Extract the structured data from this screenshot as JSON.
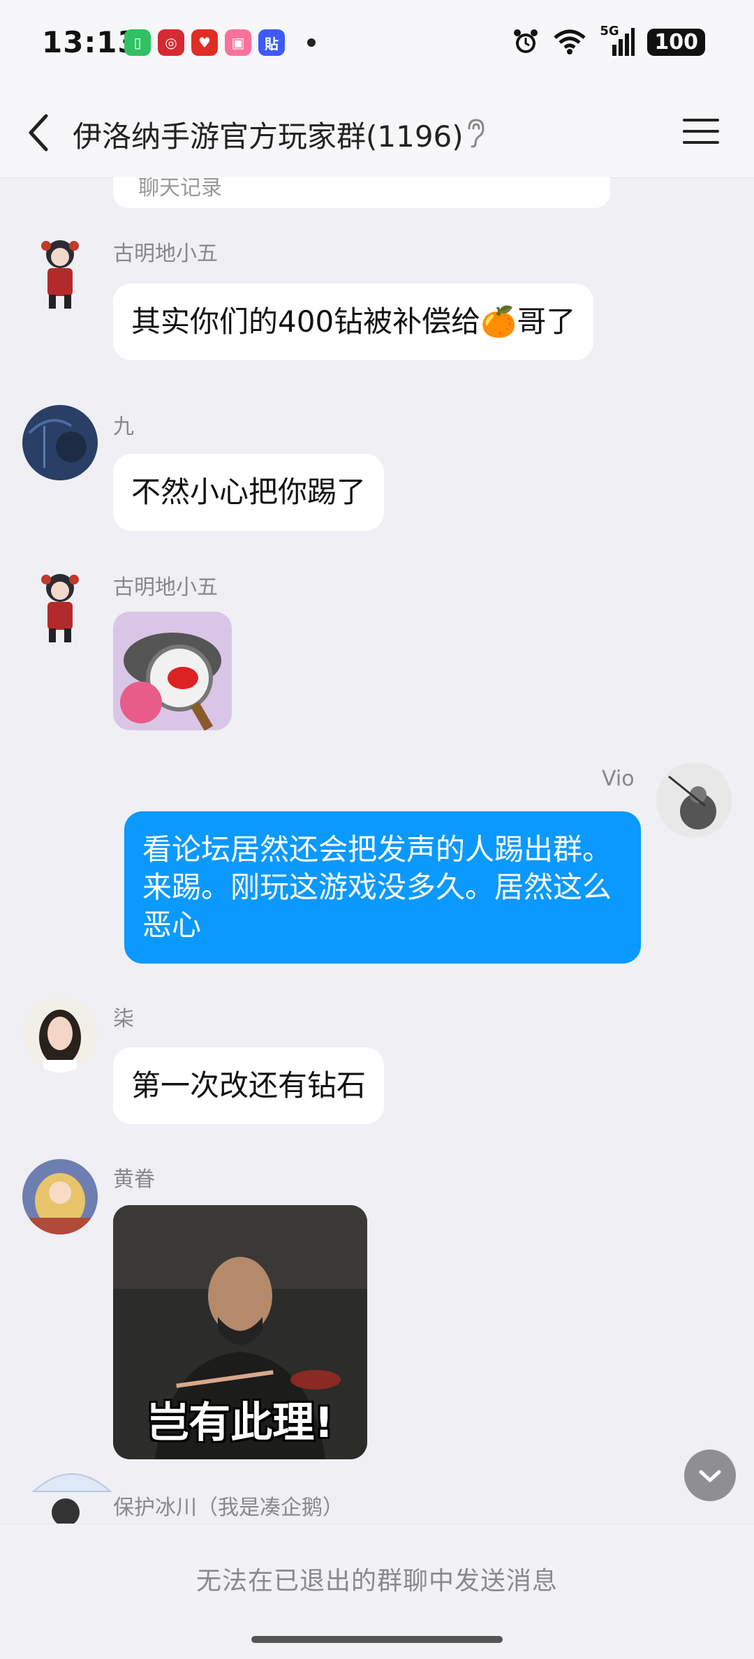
{
  "status_bar": {
    "time": "13:13",
    "network": "5G",
    "battery": "100",
    "app_icons": [
      "battery-app-icon",
      "union-pay-icon",
      "pinduoduo-icon",
      "bilibili-icon",
      "tieba-icon"
    ]
  },
  "header": {
    "title": "伊洛纳手游官方玩家群(1196)",
    "back_icon": "back-chevron-icon",
    "ear_icon": "ear-icon",
    "menu_icon": "menu-icon"
  },
  "chat": {
    "previous_card_text": "聊天记录",
    "messages": [
      {
        "sender": "古明地小五",
        "type": "text",
        "text": "其实你们的400钻被补偿给🍊哥了"
      },
      {
        "sender": "九",
        "type": "text",
        "text": "不然小心把你踢了"
      },
      {
        "sender": "古明地小五",
        "type": "image",
        "image": "magnifier-sticker"
      },
      {
        "sender": "Vio",
        "type": "text",
        "self": true,
        "text": "看论坛居然还会把发声的人踢出群。来踢。刚玩这游戏没多久。居然这么恶心"
      },
      {
        "sender": "柒",
        "type": "text",
        "text": "第一次改还有钻石"
      },
      {
        "sender": "黄眷",
        "type": "image",
        "image": "meme-sticker",
        "caption": "岂有此理!"
      },
      {
        "sender": "保护冰川（我是凑企鹅）",
        "type": "partial"
      }
    ]
  },
  "bottom": {
    "notice": "无法在已退出的群聊中发送消息"
  },
  "colors": {
    "self_bubble": "#0a99ff",
    "background": "#efeff4"
  }
}
